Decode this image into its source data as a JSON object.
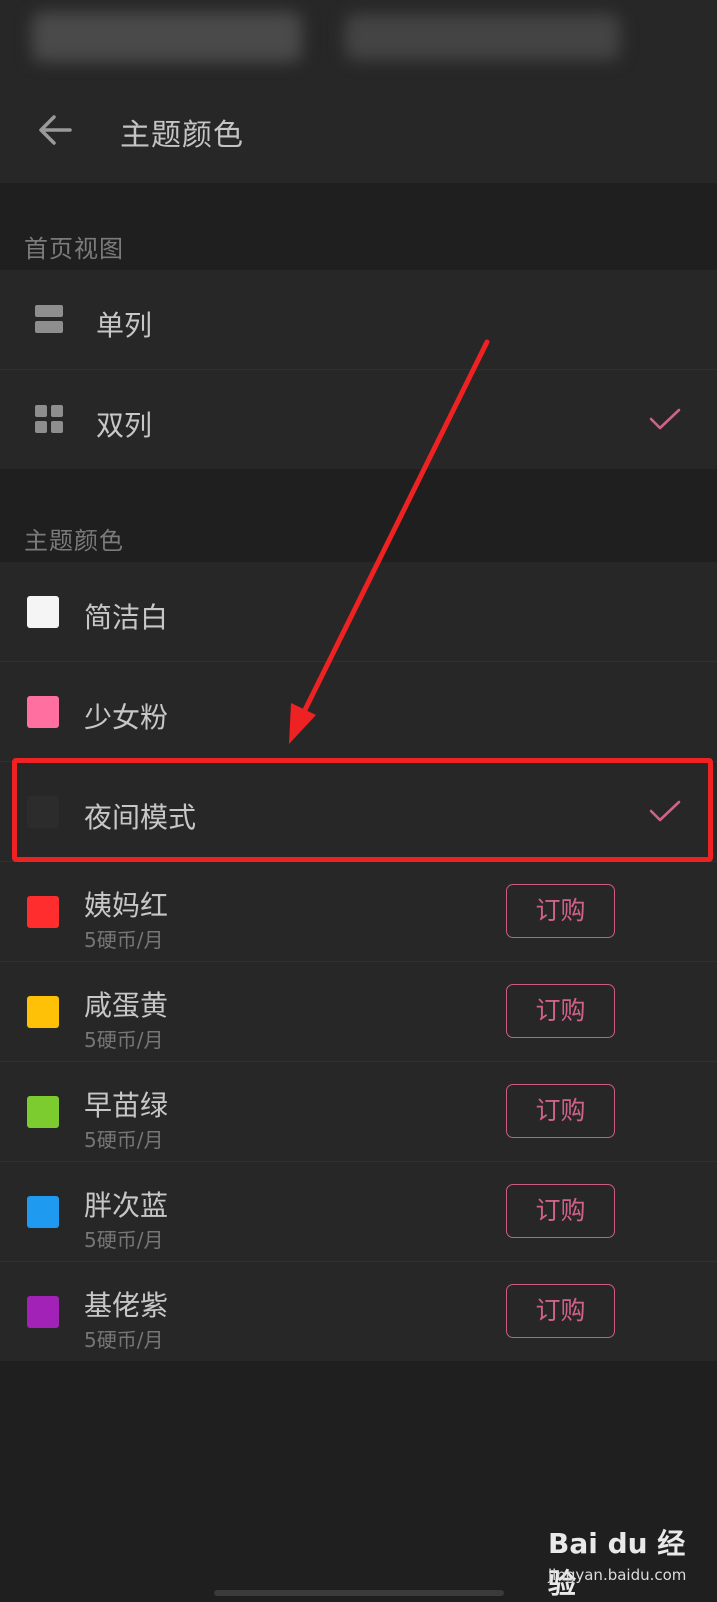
{
  "app_bar": {
    "title": "主题颜色"
  },
  "sections": {
    "home_view": {
      "label": "首页视图",
      "items": [
        {
          "label": "单列",
          "icon": "single-column-icon",
          "selected": false
        },
        {
          "label": "双列",
          "icon": "grid-icon",
          "selected": true
        }
      ]
    },
    "theme": {
      "label": "主题颜色",
      "items": [
        {
          "label": "简洁白",
          "color": "#f5f5f5",
          "selected": false
        },
        {
          "label": "少女粉",
          "color": "#ff6fa0",
          "selected": false
        },
        {
          "label": "夜间模式",
          "color": "#2c2c2c",
          "selected": true
        },
        {
          "label": "姨妈红",
          "color": "#ff2d2d",
          "price": "5硬币/月",
          "button": "订购"
        },
        {
          "label": "咸蛋黄",
          "color": "#ffc107",
          "price": "5硬币/月",
          "button": "订购"
        },
        {
          "label": "早苗绿",
          "color": "#7ccc2f",
          "price": "5硬币/月",
          "button": "订购"
        },
        {
          "label": "胖次蓝",
          "color": "#1e9bf0",
          "price": "5硬币/月",
          "button": "订购"
        },
        {
          "label": "基佬紫",
          "color": "#a222b8",
          "price": "5硬币/月",
          "button": "订购"
        }
      ]
    }
  },
  "colors": {
    "accent": "#d0628a",
    "annotation": "#ee2222",
    "background": "#1f1f1f",
    "surface": "#272727"
  },
  "watermark": {
    "logo": "Bai du 经验",
    "url": "jingyan.baidu.com"
  }
}
